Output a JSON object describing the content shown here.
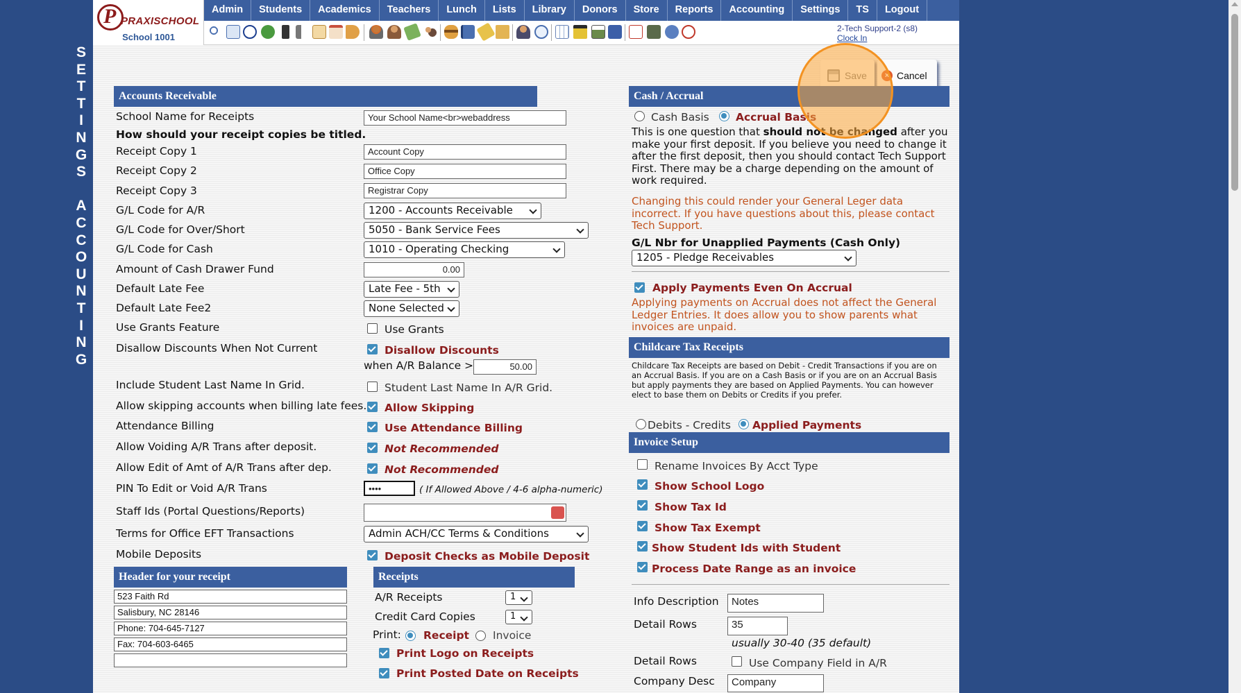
{
  "side_title": [
    "S",
    "E",
    "T",
    "T",
    "I",
    "N",
    "G",
    "S",
    " ",
    "A",
    "C",
    "C",
    "O",
    "U",
    "N",
    "T",
    "I",
    "N",
    "G"
  ],
  "logo": {
    "brand": "PRAXISCHOOL",
    "letter": "P",
    "school": "School 1001"
  },
  "nav": [
    "Admin",
    "Students",
    "Academics",
    "Teachers",
    "Lunch",
    "Lists",
    "Library",
    "Donors",
    "Store",
    "Reports",
    "Accounting",
    "Settings",
    "TS",
    "Logout"
  ],
  "user": {
    "name": "2-Tech Support-2 (s8)",
    "clock": "Clock In"
  },
  "actions": {
    "save": "Save",
    "cancel": "Cancel"
  },
  "ar": {
    "header": "Accounts Receivable",
    "school_name_label": "School Name for Receipts",
    "school_name_value": "Your School Name<br>webaddress",
    "copies_title": "How should your receipt copies be titled.",
    "copy1_label": "Receipt Copy 1",
    "copy1_value": "Account Copy",
    "copy2_label": "Receipt Copy 2",
    "copy2_value": "Office Copy",
    "copy3_label": "Receipt Copy 3",
    "copy3_value": "Registrar Copy",
    "gl_ar_label": "G/L Code for A/R",
    "gl_ar_value": "1200 - Accounts Receivable",
    "gl_os_label": "G/L Code for Over/Short",
    "gl_os_value": "5050 - Bank Service Fees",
    "gl_cash_label": "G/L Code for Cash",
    "gl_cash_value": "1010 - Operating Checking",
    "drawer_label": "Amount of Cash Drawer Fund",
    "drawer_value": "0.00",
    "late_label": "Default Late Fee",
    "late_value": "Late Fee - 5th",
    "late2_label": "Default Late Fee2",
    "late2_value": "None Selected",
    "grants_label": "Use Grants Feature",
    "grants_cb": "Use Grants",
    "disallow_label": "Disallow Discounts When Not Current",
    "disallow_cb": "Disallow Discounts",
    "balance_label": "when A/R Balance >",
    "balance_value": "50.00",
    "lastname_label": "Include Student Last Name In Grid.",
    "lastname_cb": "Student Last Name In A/R Grid.",
    "skip_label": "Allow skipping accounts when billing late fees.",
    "skip_cb": "Allow Skipping",
    "attend_label": "Attendance Billing",
    "attend_cb": "Use Attendance Billing",
    "void_label": "Allow Voiding A/R Trans after deposit.",
    "void_cb": "Not Recommended",
    "edit_label": "Allow Edit of Amt of A/R Trans after dep.",
    "edit_cb": "Not Recommended",
    "pin_label": "PIN To Edit or Void A/R Trans",
    "pin_value": "••••",
    "pin_hint": "( If Allowed Above / 4-6 alpha-numeric)",
    "staff_label": "Staff Ids (Portal Questions/Reports)",
    "terms_label": "Terms for Office EFT Transactions",
    "terms_value": "Admin ACH/CC Terms & Conditions",
    "mobile_label": "Mobile Deposits",
    "mobile_cb": "Deposit Checks as Mobile Deposit"
  },
  "receipt_header": {
    "header": "Header for your receipt",
    "lines": [
      "523 Faith Rd",
      "Salisbury, NC 28146",
      "Phone: 704-645-7127",
      "Fax: 704-603-6465",
      ""
    ]
  },
  "receipts": {
    "header": "Receipts",
    "ar_label": "A/R Receipts",
    "ar_value": "1",
    "cc_label": "Credit Card Copies",
    "cc_value": "1",
    "print_label": "Print:",
    "print_receipt": "Receipt",
    "print_invoice": "Invoice",
    "logo_cb": "Print Logo on Receipts",
    "posted_cb": "Print Posted Date on Receipts"
  },
  "cash_accrual": {
    "header": "Cash / Accrual",
    "cash": "Cash Basis",
    "accrual": "Accrual Basis",
    "para_1": "This is one question that",
    "para_bold": "should not be changed",
    "para_2": "after you make your first deposit. If you believe you need to change it after the first deposit, then you should contact Tech Support First. There may be a charge depending on the amount of work required.",
    "warning": "Changing this could render your General Leger data incorrect. If you have questions about this, please contact Tech Support.",
    "unapplied_label": "G/L Nbr for Unapplied Payments (Cash Only)",
    "unapplied_value": "1205 - Pledge Receivables",
    "apply_cb": "Apply Payments Even On Accrual",
    "apply_note": "Applying payments on Accrual does not affect the General Ledger Entries. It does allow you to show parents what invoices are unpaid."
  },
  "childcare": {
    "header": "Childcare Tax Receipts",
    "text": "Childcare Tax Receipts are based on Debit - Credit Transactions if you are on an Accrual Basis. If you are on a Cash Basis or if you are on an Accrual Basis but apply payments they are based on Applied Payments. You can however elect to base them on Debits or Credits if you prefer.",
    "opt_debits": "Debits - Credits",
    "opt_applied": "Applied Payments"
  },
  "invoice": {
    "header": "Invoice Setup",
    "rename_cb": "Rename Invoices By Acct Type",
    "logo_cb": "Show School Logo",
    "taxid_cb": "Show Tax Id",
    "taxexempt_cb": "Show Tax Exempt",
    "studentids_cb": "Show Student Ids with Student",
    "daterange_cb": "Process Date Range as an invoice",
    "info_label": "Info Description",
    "info_value": "Notes",
    "rows_label": "Detail Rows",
    "rows_value": "35",
    "rows_hint": "usually 30-40 (35 default)",
    "rows2_label": "Detail Rows",
    "company_cb": "Use Company Field in A/R",
    "company_label": "Company Desc",
    "company_value": "Company"
  }
}
